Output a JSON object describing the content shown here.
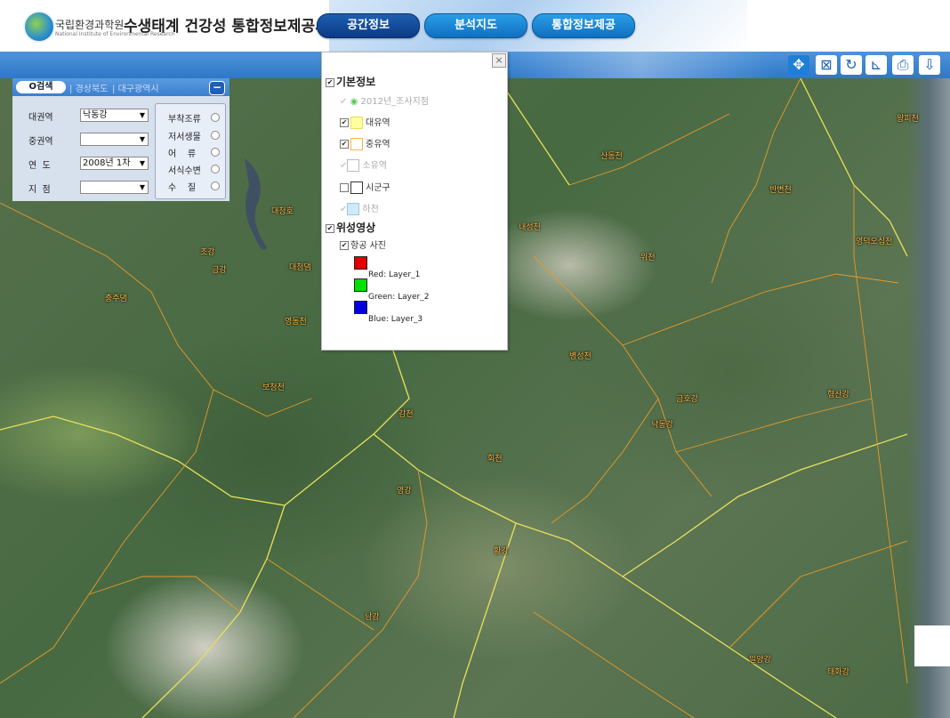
{
  "header": {
    "org_name": "국립환경과학원",
    "org_sub": "National Institute of Environmental Research",
    "system_title": "수생태계 건강성 통합정보제공시스템",
    "nav": [
      "공간정보",
      "분석지도",
      "통합정보제공"
    ]
  },
  "toolbar": {
    "icons": [
      "pan-icon",
      "full-extent-icon",
      "refresh-icon",
      "measure-icon",
      "print-icon",
      "save-icon"
    ]
  },
  "search_panel": {
    "tab": "O검색",
    "links": [
      "경상북도",
      "대구광역시"
    ],
    "collapse": "−",
    "fields": [
      {
        "label": "대권역",
        "value": "낙동강"
      },
      {
        "label": "중권역",
        "value": ""
      },
      {
        "label": "연  도",
        "value": "2008년 1차"
      },
      {
        "label": "지  점",
        "value": ""
      }
    ],
    "observation_types": [
      "부착조류",
      "저서생물",
      "어    류",
      "서식수변",
      "수    질"
    ]
  },
  "layer_panel": {
    "close": "×",
    "basic_header": "기본정보",
    "basic_items": [
      {
        "label": "2012년_조사지점",
        "checked": true,
        "enabled": false
      },
      {
        "label": "대유역",
        "checked": true,
        "enabled": true,
        "color": "#ffffa0"
      },
      {
        "label": "중유역",
        "checked": true,
        "enabled": true,
        "color": "#ffb347"
      },
      {
        "label": "소유역",
        "checked": true,
        "enabled": false,
        "color": "#ffffff"
      },
      {
        "label": "시군구",
        "checked": false,
        "enabled": true,
        "color": "#ffffff"
      },
      {
        "label": "하천",
        "checked": true,
        "enabled": false,
        "color": "#cfe9ff"
      }
    ],
    "satellite_header": "위성영상",
    "aerial_label": "항공 사진",
    "bands": [
      {
        "label": "Red: Layer_1",
        "color": "#e00000"
      },
      {
        "label": "Green: Layer_2",
        "color": "#00e000"
      },
      {
        "label": "Blue: Layer_3",
        "color": "#0000e0"
      }
    ]
  },
  "map": {
    "place_labels": [
      "대청호",
      "금강",
      "대청댐",
      "보청천",
      "초강",
      "충주댐",
      "산동천",
      "영동천",
      "금호강",
      "낙동강",
      "위천",
      "회천",
      "내성천",
      "영강",
      "남강",
      "황강",
      "밀양강",
      "형산강",
      "태화강",
      "감천",
      "병성천",
      "반변천",
      "왕피천",
      "영덕오십천"
    ]
  }
}
